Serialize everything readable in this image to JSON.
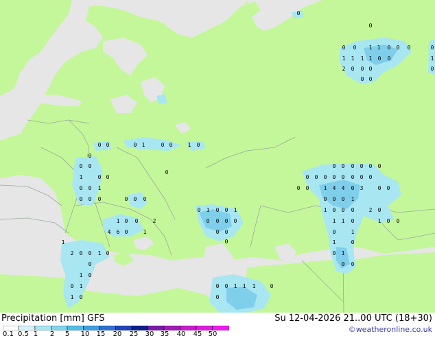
{
  "map": {
    "palette": {
      "sea": "#e6e6e6",
      "land": "#c4f79a",
      "border": "#9aa79a",
      "precip_light": "#a8e6f2",
      "precip_mid": "#7fcfeb",
      "precip_heavy": "#4fb3e0"
    },
    "point_values": [
      "0",
      "0",
      "1",
      "1",
      "0",
      "0",
      "0",
      "0",
      "1",
      "1",
      "1",
      "1",
      "0",
      "0",
      "1",
      "2",
      "0",
      "0",
      "0",
      "0",
      "0",
      "0",
      "0",
      "0",
      "0",
      "0",
      "0",
      "1",
      "0",
      "0",
      "1",
      "0",
      "0",
      "0",
      "0",
      "1",
      "0",
      "0",
      "0",
      "0",
      "1",
      "0",
      "0",
      "0",
      "0",
      "0",
      "0",
      "0",
      "0",
      "1",
      "0",
      "0",
      "1",
      "0",
      "0",
      "0",
      "0",
      "1",
      "0",
      "0",
      "2",
      "4",
      "6",
      "0",
      "1",
      "0",
      "0",
      "0",
      "0",
      "0",
      "0",
      "0",
      "0",
      "0",
      "0",
      "0",
      "0",
      "0",
      "0",
      "0",
      "0",
      "0",
      "0",
      "0",
      "1",
      "4",
      "4",
      "0",
      "3",
      "0",
      "0",
      "0",
      "0",
      "0",
      "1",
      "1",
      "0",
      "0",
      "0",
      "2",
      "0",
      "1",
      "1",
      "0",
      "1",
      "0",
      "0",
      "0",
      "1",
      "1",
      "0",
      "0",
      "1",
      "0",
      "0",
      "1",
      "2",
      "0",
      "0",
      "1",
      "0",
      "0",
      "1",
      "0",
      "0",
      "1",
      "1",
      "0",
      "0",
      "0",
      "1",
      "1",
      "1",
      "0",
      "0"
    ]
  },
  "legend": {
    "title": "Precipitation [mm] GFS",
    "ticks": [
      "0.1",
      "0.5",
      "1",
      "2",
      "5",
      "10",
      "15",
      "20",
      "25",
      "30",
      "35",
      "40",
      "45",
      "50"
    ],
    "colors": [
      "#ffffff",
      "#d6f3fb",
      "#a8e6f2",
      "#7fd6ee",
      "#4fbfe6",
      "#3f9ee0",
      "#2f6fd0",
      "#1f44b8",
      "#0a1e8c",
      "#7a1aa8",
      "#a01ab8",
      "#c81ad0",
      "#e01ae0",
      "#f01af0"
    ]
  },
  "valid_time": "Su 12-04-2026 21..00 UTC (18+30)",
  "credit": "©weatheronline.co.uk"
}
